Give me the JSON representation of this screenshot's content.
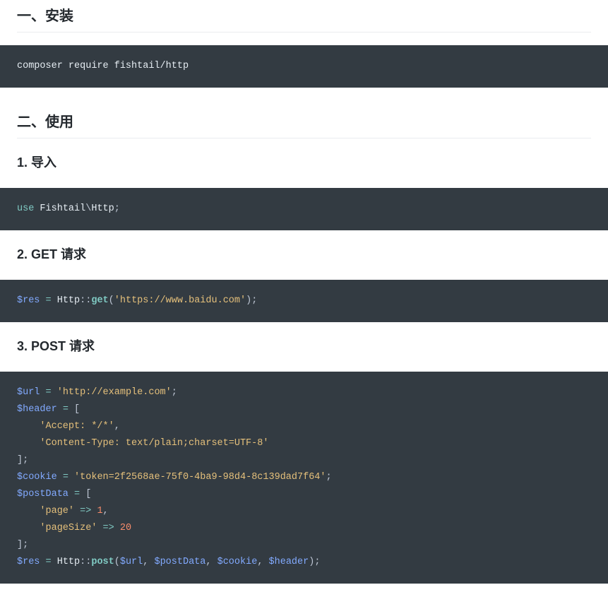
{
  "headings": {
    "install": "一、安装",
    "usage": "二、使用",
    "import": "1. 导入",
    "get": "2. GET 请求",
    "post": "3. POST 请求"
  },
  "code": {
    "install": {
      "line1": "composer require fishtail/http"
    },
    "import": {
      "kw_use": "use",
      "ns1": " Fishtail",
      "bs": "\\",
      "ns2": "Http",
      "semi": ";"
    },
    "get": {
      "var_res": "$res",
      "sp1": " ",
      "eq": "=",
      "sp2": " ",
      "cls": "Http",
      "dd": "::",
      "method": "get",
      "lp": "(",
      "url": "'https://www.baidu.com'",
      "rp": ")",
      "semi": ";"
    },
    "post": {
      "l1": {
        "var": "$url",
        "sp1": " ",
        "eq": "=",
        "sp2": " ",
        "str": "'http://example.com'",
        "semi": ";"
      },
      "l2": {
        "var": "$header",
        "sp1": " ",
        "eq": "=",
        "sp2": " ",
        "lb": "["
      },
      "l3": {
        "indent": "    ",
        "str": "'Accept: */*'",
        "comma": ","
      },
      "l4": {
        "indent": "    ",
        "str": "'Content-Type: text/plain;charset=UTF-8'"
      },
      "l5": {
        "rb": "]",
        "semi": ";"
      },
      "l6": {
        "var": "$cookie",
        "sp1": " ",
        "eq": "=",
        "sp2": " ",
        "str": "'token=2f2568ae-75f0-4ba9-98d4-8c139dad7f64'",
        "semi": ";"
      },
      "l7": {
        "var": "$postData",
        "sp1": " ",
        "eq": "=",
        "sp2": " ",
        "lb": "["
      },
      "l8": {
        "indent": "    ",
        "key": "'page'",
        "sp1": " ",
        "arrow": "=>",
        "sp2": " ",
        "num": "1",
        "comma": ","
      },
      "l9": {
        "indent": "    ",
        "key": "'pageSize'",
        "sp1": " ",
        "arrow": "=>",
        "sp2": " ",
        "num": "20"
      },
      "l10": {
        "rb": "]",
        "semi": ";"
      },
      "l11": {
        "var_res": "$res",
        "sp1": " ",
        "eq": "=",
        "sp2": " ",
        "cls": "Http",
        "dd": "::",
        "method": "post",
        "lp": "(",
        "a1": "$url",
        "c1": ", ",
        "a2": "$postData",
        "c2": ", ",
        "a3": "$cookie",
        "c3": ", ",
        "a4": "$header",
        "rp": ")",
        "semi": ";"
      }
    }
  }
}
